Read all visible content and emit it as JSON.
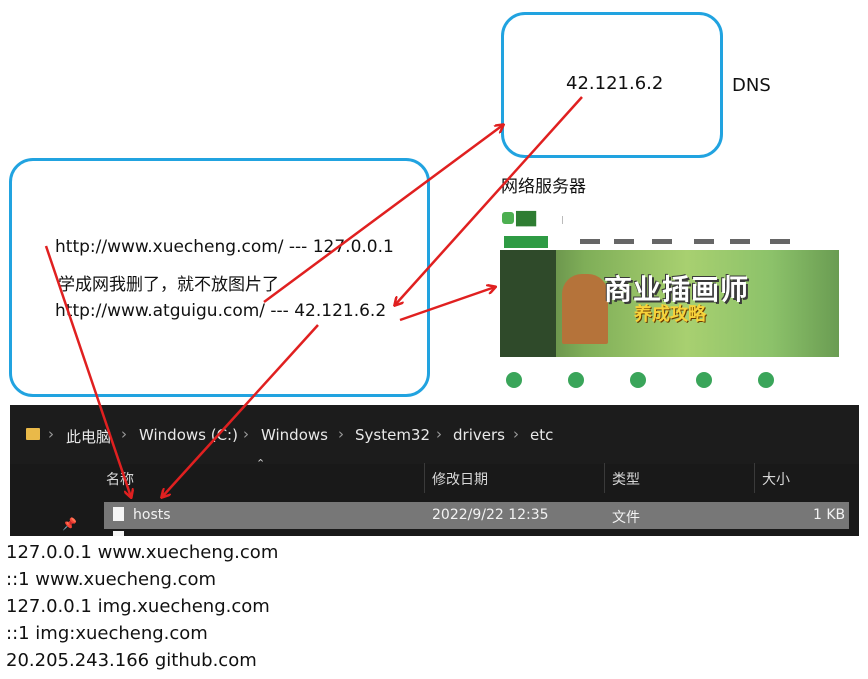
{
  "dns_box": {
    "ip": "42.121.6.2",
    "label": "DNS"
  },
  "left_box": {
    "line1": "http://www.xuecheng.com/ --- 127.0.0.1",
    "line2": "学成网我删了，就不放图片了",
    "line3": "http://www.atguigu.com/ --- 42.121.6.2"
  },
  "server": {
    "label": "网络服务器",
    "banner_title": "商业插画师",
    "banner_subtitle": "养成攻略"
  },
  "explorer": {
    "breadcrumb": [
      "此电脑",
      "Windows (C:)",
      "Windows",
      "System32",
      "drivers",
      "etc"
    ],
    "columns": [
      "名称",
      "修改日期",
      "类型",
      "大小"
    ],
    "file": {
      "name": "hosts",
      "modified": "2022/9/22 12:35",
      "type": "文件",
      "size": "1 KB"
    }
  },
  "hosts_lines": [
    "127.0.0.1 www.xuecheng.com",
    "::1 www.xuecheng.com",
    "127.0.0.1 img.xuecheng.com",
    "::1 img:xuecheng.com",
    "20.205.243.166 github.com"
  ],
  "colors": {
    "box_border": "#21a3e0",
    "arrow": "#e02020",
    "explorer_bg": "#191919",
    "selected_row": "#777777"
  }
}
